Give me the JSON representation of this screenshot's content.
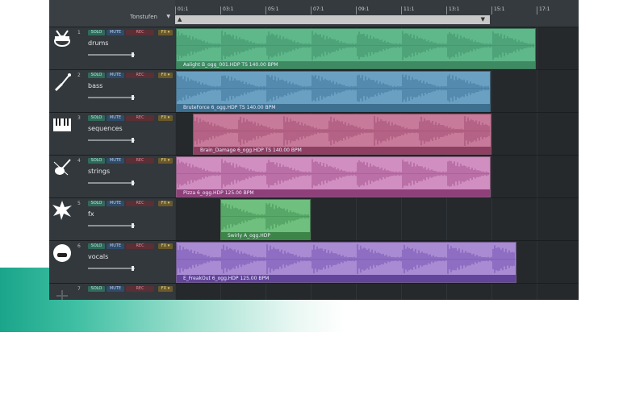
{
  "header": {
    "column_label": "Tonstufen",
    "dropdown_caret": "▼"
  },
  "ruler": {
    "markers": [
      "01:1",
      "03:1",
      "05:1",
      "07:1",
      "09:1",
      "11:1",
      "13:1",
      "15:1",
      "17:1"
    ],
    "loop_start_marker": "▲",
    "loop_end_marker": "▼"
  },
  "button_labels": {
    "solo": "SOLO",
    "mute": "MUTE",
    "rec": "REC",
    "fx": "FX ▾"
  },
  "tracks": [
    {
      "number": "1",
      "name": "drums",
      "icon": "drum-icon",
      "clip": {
        "caption": "Aalight B_ogg_001.HDP  TS  140.00 BPM",
        "color": "#5fb88a",
        "wave": "#3d8f66",
        "caption_bg": "#3e8a62"
      }
    },
    {
      "number": "2",
      "name": "bass",
      "icon": "bass-guitar-icon",
      "clip": {
        "caption": "BruteForce 6_ogg.HDP  TS  140.00 BPM",
        "color": "#6aa0c2",
        "wave": "#3f7598",
        "caption_bg": "#3d6f8f"
      }
    },
    {
      "number": "3",
      "name": "sequences",
      "icon": "keyboard-icon",
      "clip": {
        "caption": "Brain_Damage 6_ogg.HDP  TS  140.00 BPM",
        "color": "#c77a9a",
        "wave": "#a04a70",
        "caption_bg": "#8f3f62"
      }
    },
    {
      "number": "4",
      "name": "strings",
      "icon": "violin-icon",
      "clip": {
        "caption": "Pizza 6_ogg.HDP  125.00 BPM",
        "color": "#d08fc0",
        "wave": "#a4508e",
        "caption_bg": "#8f3f7a"
      }
    },
    {
      "number": "5",
      "name": "fx",
      "icon": "explosion-icon",
      "clip": {
        "caption": "Swirly A_ogg.HDP",
        "color": "#6fbf7f",
        "wave": "#3f9050",
        "caption_bg": "#3c8448"
      }
    },
    {
      "number": "6",
      "name": "vocals",
      "icon": "face-icon",
      "clip": {
        "caption": "E_FreakOut 6_ogg.HDP  125.00 BPM",
        "color": "#a98bd3",
        "wave": "#7452b0",
        "caption_bg": "#62449a"
      }
    },
    {
      "number": "7",
      "name": "",
      "icon": "add-track-icon"
    }
  ]
}
